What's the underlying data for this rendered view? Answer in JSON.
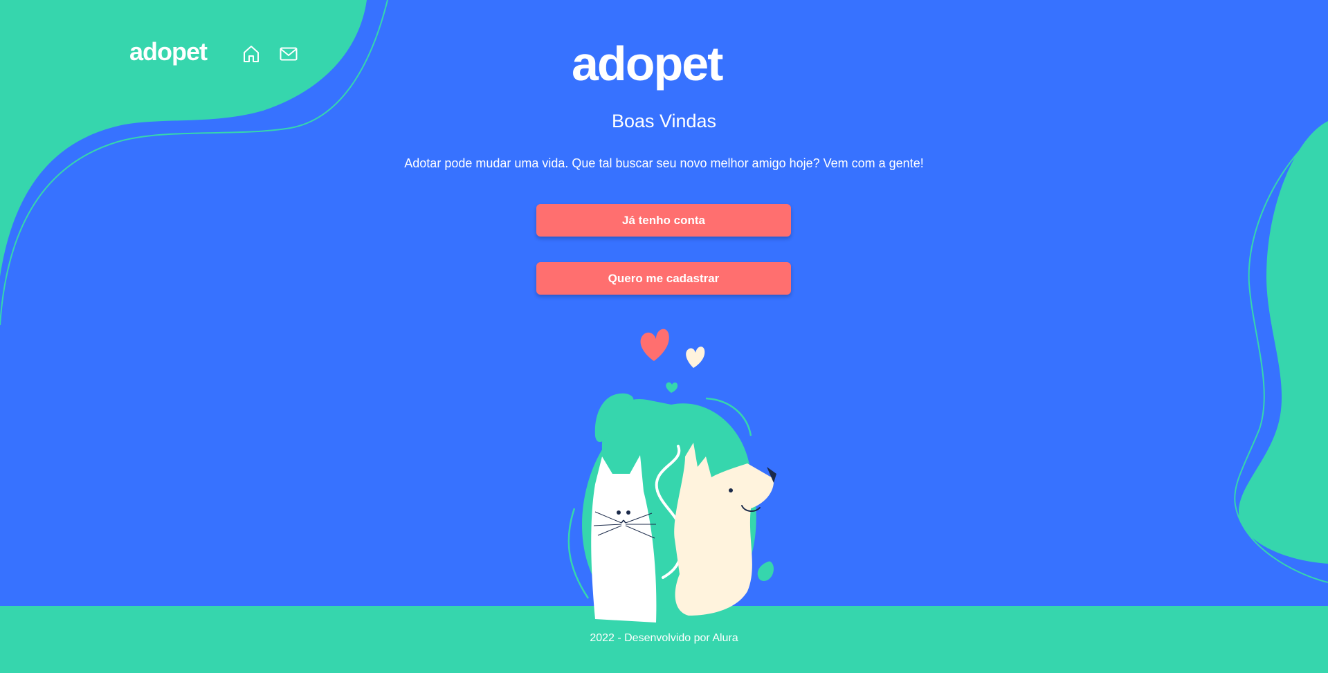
{
  "brand": {
    "logo_text": "adopet",
    "colors": {
      "background": "#3772FF",
      "accent_green": "#36D6AD",
      "button": "#FF6F6F",
      "text": "#FFFFFF",
      "cream": "#FFF3DD"
    }
  },
  "nav": {
    "logo_text": "adopet",
    "items": [
      {
        "icon": "home-icon"
      },
      {
        "icon": "mail-icon"
      }
    ]
  },
  "hero": {
    "logo_text": "adopet",
    "title": "Boas Vindas",
    "subtitle": "Adotar pode mudar uma vida. Que tal buscar seu novo melhor amigo hoje? Vem com a gente!",
    "buttons": {
      "login_label": "Já tenho conta",
      "register_label": "Quero me cadastrar"
    },
    "illustration": "cat-and-dog-illustration"
  },
  "footer": {
    "text": "2022 - Desenvolvido por Alura"
  }
}
